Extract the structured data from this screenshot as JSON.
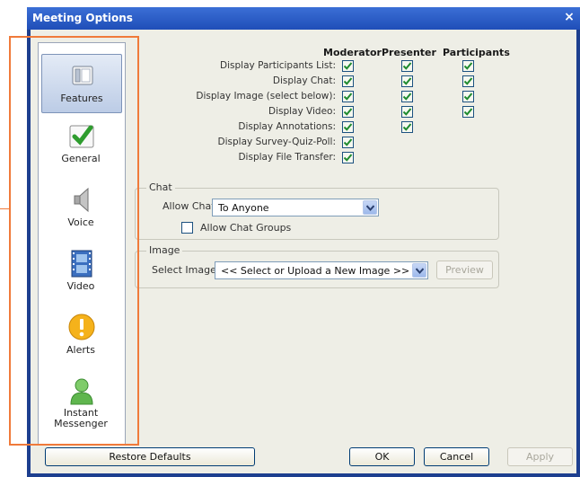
{
  "window": {
    "title": "Meeting Options",
    "close_glyph": "×"
  },
  "sidebar": {
    "items": [
      {
        "label": "Features",
        "icon": "features-icon",
        "active": true
      },
      {
        "label": "General",
        "icon": "checkbox-icon"
      },
      {
        "label": "Voice",
        "icon": "speaker-icon"
      },
      {
        "label": "Video",
        "icon": "film-icon"
      },
      {
        "label": "Alerts",
        "icon": "alert-icon"
      },
      {
        "label": "Instant Messenger",
        "icon": "user-icon"
      }
    ]
  },
  "features": {
    "columns": [
      "Moderator",
      "Presenter",
      "Participants"
    ],
    "rows": [
      {
        "label": "Display Participants List:",
        "checks": [
          true,
          true,
          true
        ]
      },
      {
        "label": "Display Chat:",
        "checks": [
          true,
          true,
          true
        ]
      },
      {
        "label": "Display Image (select below):",
        "checks": [
          true,
          true,
          true
        ]
      },
      {
        "label": "Display Video:",
        "checks": [
          true,
          true,
          true
        ]
      },
      {
        "label": "Display Annotations:",
        "checks": [
          true,
          true,
          false
        ]
      },
      {
        "label": "Display Survey-Quiz-Poll:",
        "checks": [
          true,
          false,
          false
        ]
      },
      {
        "label": "Display File Transfer:",
        "checks": [
          true,
          false,
          false
        ]
      }
    ]
  },
  "chat": {
    "legend": "Chat",
    "allow_label": "Allow Chat:",
    "allow_value": "To Anyone",
    "groups_label": "Allow Chat Groups",
    "groups_checked": false
  },
  "image": {
    "legend": "Image",
    "select_label": "Select Image:",
    "select_value": "<< Select or Upload a New Image >>",
    "preview_label": "Preview"
  },
  "footer": {
    "restore_label": "Restore Defaults",
    "ok_label": "OK",
    "cancel_label": "Cancel",
    "apply_label": "Apply"
  },
  "colors": {
    "accent_highlight": "#f07a3a",
    "title_bar": "#2a59c4",
    "check": "#1e8a2e"
  }
}
